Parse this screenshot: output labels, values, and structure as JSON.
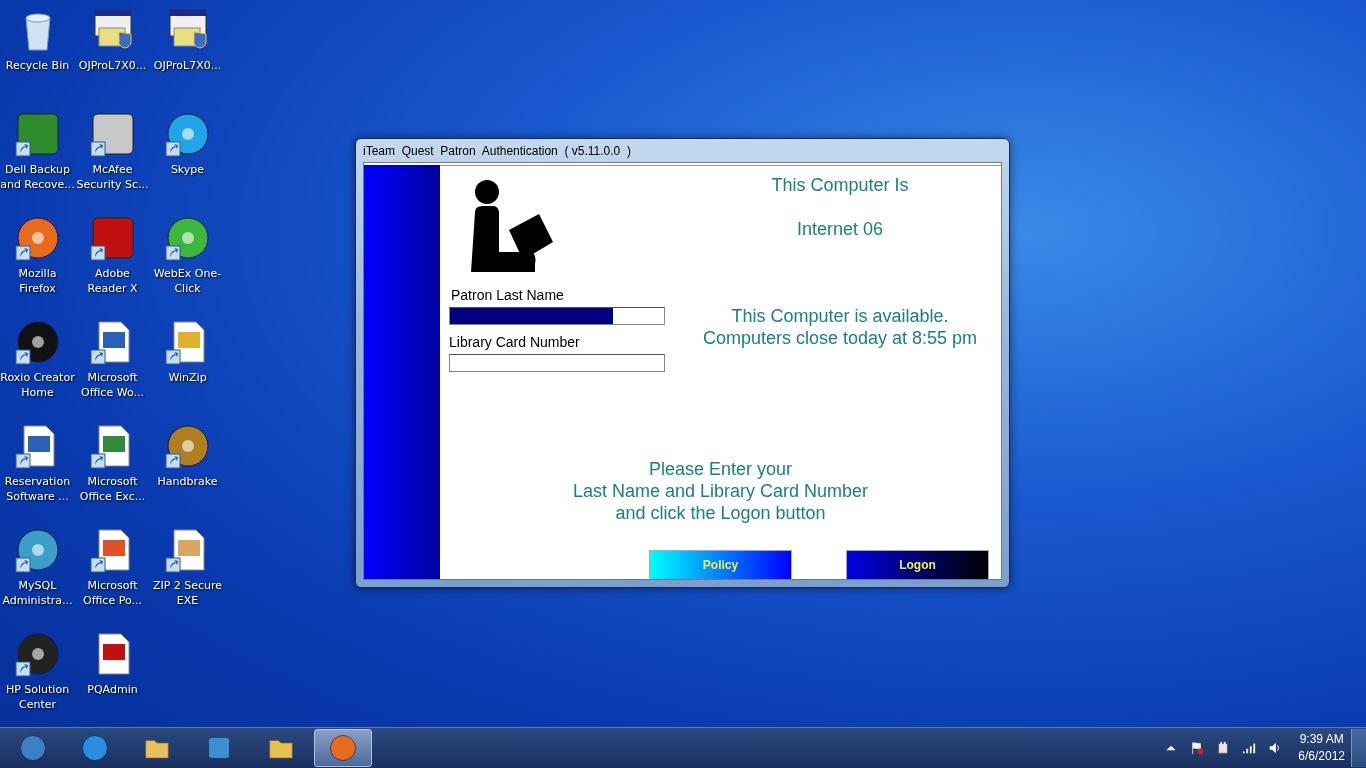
{
  "desktop_icons": [
    {
      "label": "Recycle Bin",
      "shortcut": false
    },
    {
      "label": "OJProL7X0...",
      "shortcut": false
    },
    {
      "label": "OJProL7X0...",
      "shortcut": false
    },
    {
      "label": "Dell Backup and Recove...",
      "shortcut": true
    },
    {
      "label": "McAfee Security Sc...",
      "shortcut": true
    },
    {
      "label": "Skype",
      "shortcut": true
    },
    {
      "label": "Mozilla Firefox",
      "shortcut": true
    },
    {
      "label": "Adobe Reader X",
      "shortcut": true
    },
    {
      "label": "WebEx One-Click",
      "shortcut": true
    },
    {
      "label": "Roxio Creator Home",
      "shortcut": true
    },
    {
      "label": "Microsoft Office Wo...",
      "shortcut": true
    },
    {
      "label": "WinZip",
      "shortcut": true
    },
    {
      "label": "Reservation Software ...",
      "shortcut": true
    },
    {
      "label": "Microsoft Office Exc...",
      "shortcut": true
    },
    {
      "label": "Handbrake",
      "shortcut": true
    },
    {
      "label": "MySQL Administra...",
      "shortcut": true
    },
    {
      "label": "Microsoft Office Po...",
      "shortcut": true
    },
    {
      "label": "ZIP 2 Secure EXE",
      "shortcut": true
    },
    {
      "label": "HP Solution Center",
      "shortcut": true
    },
    {
      "label": "PQAdmin",
      "shortcut": false
    }
  ],
  "window": {
    "title": "iTeam  Quest  Patron  Authentication  ( v5.11.0.0  )",
    "last_name": {
      "label": "Patron Last Name",
      "level": 0.76
    },
    "card_number": {
      "label": "Library Card Number"
    },
    "computer_heading": "This Computer Is",
    "computer_name": "Internet 06",
    "status_lines": [
      "This Computer is available.",
      "Computers close today at 8:55 pm"
    ],
    "instructions": [
      "Please Enter your",
      "Last Name and Library Card Number",
      "and click the Logon button"
    ],
    "buttons": [
      {
        "label": "Policy",
        "kind": "light"
      },
      {
        "label": "Logon",
        "kind": "dark"
      }
    ]
  },
  "taskbar": {
    "items": [
      {
        "selected": false
      },
      {
        "selected": false
      },
      {
        "selected": false
      },
      {
        "selected": false
      },
      {
        "selected": false
      },
      {
        "selected": true
      }
    ],
    "time": "9:39 AM",
    "date": "6/6/2012"
  }
}
